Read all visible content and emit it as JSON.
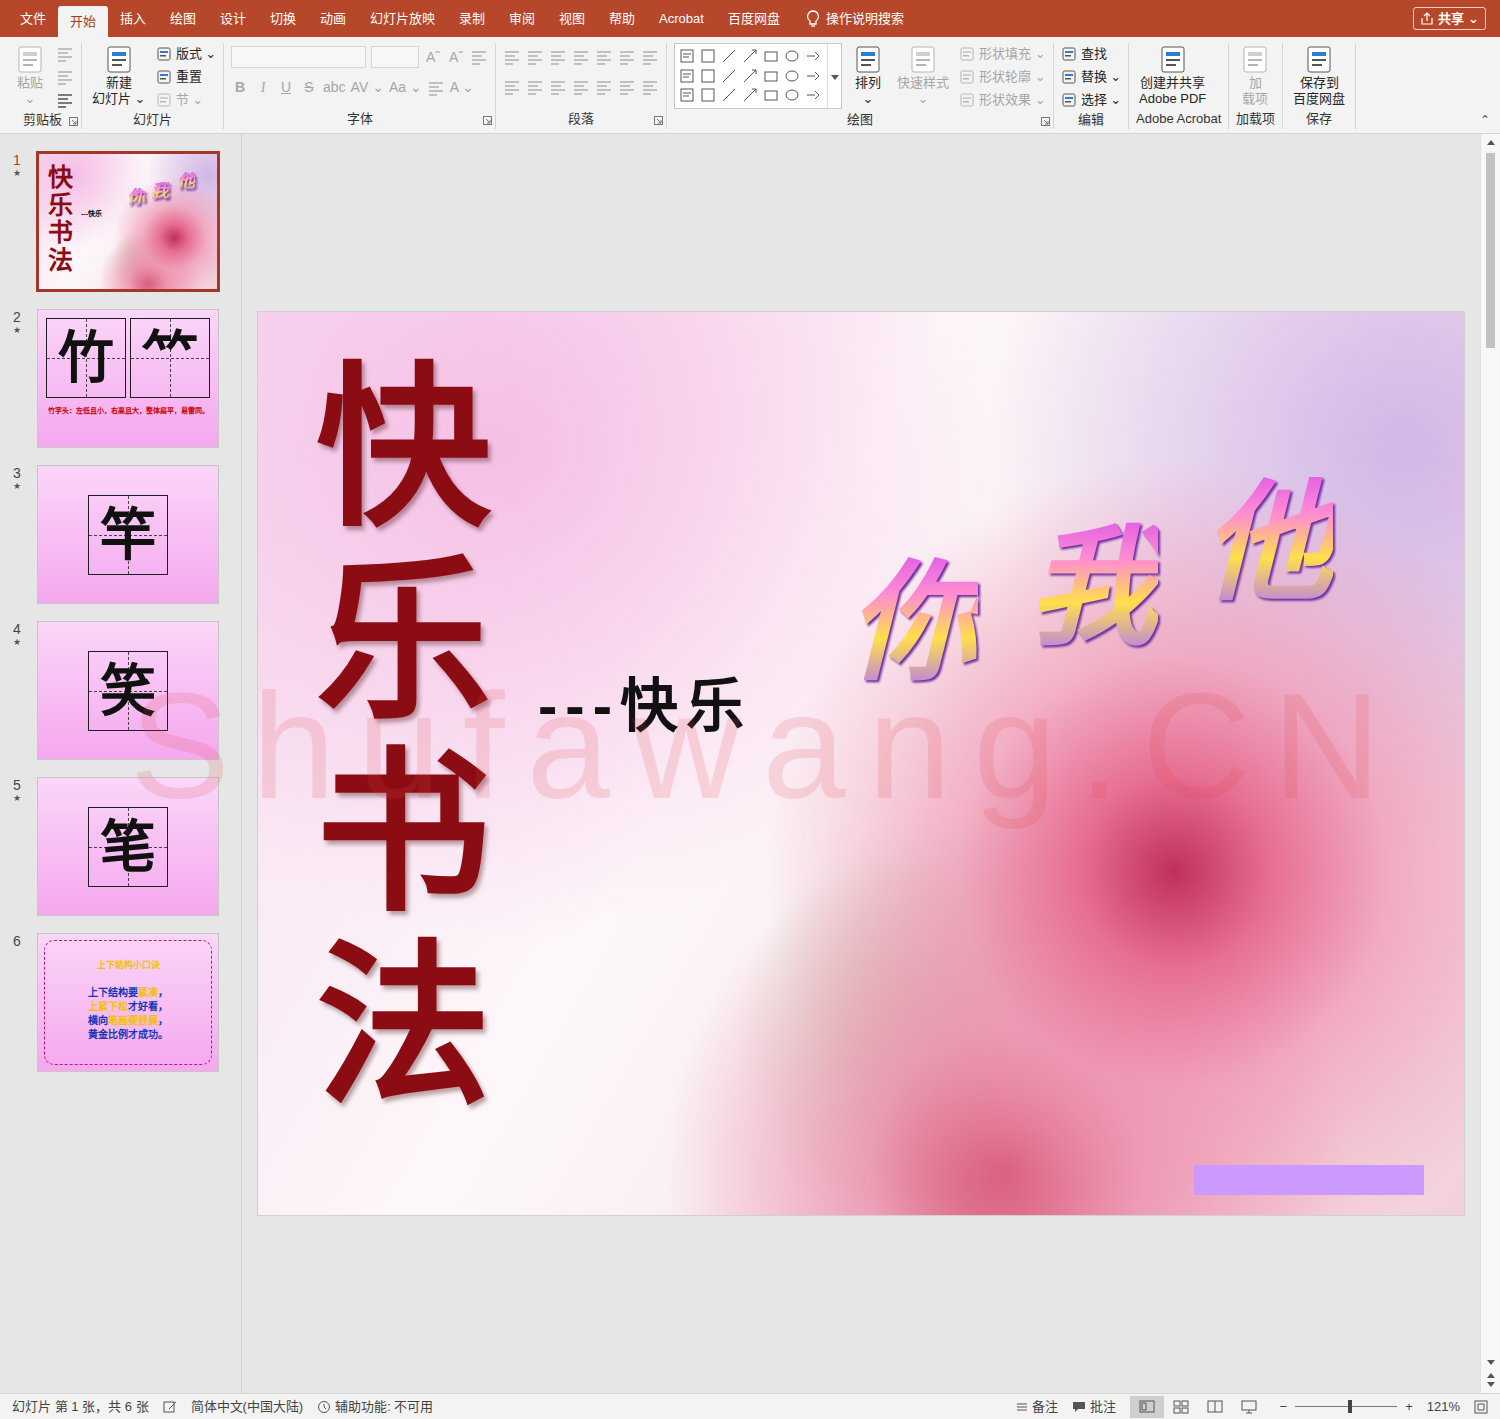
{
  "menu": {
    "tabs": [
      {
        "label": "文件",
        "selected": false
      },
      {
        "label": "开始",
        "selected": true
      },
      {
        "label": "插入",
        "selected": false
      },
      {
        "label": "绘图",
        "selected": false
      },
      {
        "label": "设计",
        "selected": false
      },
      {
        "label": "切换",
        "selected": false
      },
      {
        "label": "动画",
        "selected": false
      },
      {
        "label": "幻灯片放映",
        "selected": false
      },
      {
        "label": "录制",
        "selected": false
      },
      {
        "label": "审阅",
        "selected": false
      },
      {
        "label": "视图",
        "selected": false
      },
      {
        "label": "帮助",
        "selected": false
      },
      {
        "label": "Acrobat",
        "selected": false
      },
      {
        "label": "百度网盘",
        "selected": false
      }
    ],
    "search": "操作说明搜索",
    "share": "共享",
    "share_arrow": "⌄"
  },
  "ribbon": {
    "collapse": "⌃",
    "groups": [
      {
        "label": "剪贴板",
        "launcher": true,
        "blocks": [
          {
            "kind": "large",
            "lines": [
              "粘贴",
              "⌄"
            ],
            "disabled": true
          },
          {
            "kind": "stack",
            "rows": [
              [
                {
                  "kind": "icon",
                  "disabled": true
                }
              ],
              [
                {
                  "kind": "icon",
                  "disabled": true
                }
              ],
              [
                {
                  "kind": "icon",
                  "disabled": false
                }
              ]
            ]
          }
        ]
      },
      {
        "label": "幻灯片",
        "launcher": false,
        "blocks": [
          {
            "kind": "large",
            "lines": [
              "新建",
              "幻灯片 ⌄"
            ],
            "disabled": false
          },
          {
            "kind": "stack",
            "rows": [
              [
                {
                  "kind": "small",
                  "label": "版式 ⌄",
                  "disabled": false
                }
              ],
              [
                {
                  "kind": "small",
                  "label": "重置",
                  "disabled": false
                }
              ],
              [
                {
                  "kind": "small",
                  "label": "节 ⌄",
                  "disabled": true
                }
              ]
            ]
          }
        ]
      },
      {
        "label": "字体",
        "launcher": true,
        "blocks": [
          {
            "kind": "font",
            "rows": [
              [
                {
                  "kind": "field",
                  "disabled": true
                },
                {
                  "kind": "field",
                  "disabled": true
                },
                {
                  "kind": "glyph",
                  "label": "Aˆ",
                  "disabled": true
                },
                {
                  "kind": "glyph",
                  "label": "Aˇ",
                  "disabled": true
                },
                {
                  "kind": "icon",
                  "disabled": true
                }
              ],
              [
                {
                  "kind": "glyph",
                  "label": "B",
                  "disabled": true
                },
                {
                  "kind": "glyph",
                  "label": "I",
                  "disabled": true
                },
                {
                  "kind": "glyph",
                  "label": "U",
                  "disabled": true
                },
                {
                  "kind": "glyph",
                  "label": "S",
                  "disabled": true
                },
                {
                  "kind": "glyph",
                  "label": "abc",
                  "disabled": true
                },
                {
                  "kind": "glyph",
                  "label": "AV ⌄",
                  "disabled": true
                },
                {
                  "kind": "glyph",
                  "label": "Aa ⌄",
                  "disabled": true
                },
                {
                  "kind": "icon",
                  "disabled": true
                },
                {
                  "kind": "glyph",
                  "label": "A ⌄",
                  "disabled": true
                }
              ]
            ]
          }
        ]
      },
      {
        "label": "段落",
        "launcher": true,
        "blocks": [
          {
            "kind": "font",
            "rows": [
              [
                {
                  "kind": "icon",
                  "disabled": true
                },
                {
                  "kind": "icon",
                  "disabled": true
                },
                {
                  "kind": "icon",
                  "disabled": true
                },
                {
                  "kind": "icon",
                  "disabled": true
                },
                {
                  "kind": "icon",
                  "disabled": true
                },
                {
                  "kind": "icon",
                  "disabled": true
                },
                {
                  "kind": "icon",
                  "disabled": true
                }
              ],
              [
                {
                  "kind": "icon",
                  "disabled": true
                },
                {
                  "kind": "icon",
                  "disabled": true
                },
                {
                  "kind": "icon",
                  "disabled": true
                },
                {
                  "kind": "icon",
                  "disabled": true
                },
                {
                  "kind": "icon",
                  "disabled": true
                },
                {
                  "kind": "icon",
                  "disabled": true
                },
                {
                  "kind": "icon",
                  "disabled": true
                }
              ]
            ]
          }
        ]
      },
      {
        "label": "绘图",
        "launcher": true,
        "blocks": [
          {
            "kind": "gallery"
          },
          {
            "kind": "large",
            "lines": [
              "排列",
              "⌄"
            ],
            "disabled": false
          },
          {
            "kind": "large",
            "lines": [
              "快速样式",
              "⌄"
            ],
            "disabled": true
          },
          {
            "kind": "stack",
            "rows": [
              [
                {
                  "kind": "small",
                  "label": "形状填充 ⌄",
                  "disabled": true
                }
              ],
              [
                {
                  "kind": "small",
                  "label": "形状轮廓 ⌄",
                  "disabled": true
                }
              ],
              [
                {
                  "kind": "small",
                  "label": "形状效果 ⌄",
                  "disabled": true
                }
              ]
            ]
          }
        ]
      },
      {
        "label": "编辑",
        "launcher": false,
        "blocks": [
          {
            "kind": "stack",
            "rows": [
              [
                {
                  "kind": "small",
                  "label": "查找",
                  "disabled": false
                }
              ],
              [
                {
                  "kind": "small",
                  "label": "替换 ⌄",
                  "disabled": false
                }
              ],
              [
                {
                  "kind": "small",
                  "label": "选择 ⌄",
                  "disabled": false
                }
              ]
            ]
          }
        ]
      },
      {
        "label": "Adobe Acrobat",
        "launcher": false,
        "blocks": [
          {
            "kind": "large",
            "lines": [
              "创建并共享",
              "Adobe PDF"
            ],
            "disabled": false
          }
        ]
      },
      {
        "label": "加载项",
        "launcher": false,
        "blocks": [
          {
            "kind": "large",
            "lines": [
              "加",
              "载项"
            ],
            "disabled": true
          }
        ]
      },
      {
        "label": "保存",
        "launcher": false,
        "blocks": [
          {
            "kind": "large",
            "lines": [
              "保存到",
              "百度网盘"
            ],
            "disabled": false
          }
        ]
      }
    ]
  },
  "thumbnails": [
    {
      "number": "1",
      "star": "★",
      "selected": true,
      "kind": "title",
      "title": "快乐书法",
      "subtitle": "---快乐",
      "names": [
        "你",
        "我",
        "他"
      ]
    },
    {
      "number": "2",
      "star": "★",
      "selected": false,
      "kind": "char-pair",
      "chars": [
        "竹",
        "⺮"
      ],
      "note": "竹字头：左低且小，右高且大，整体扁平，易雷同。"
    },
    {
      "number": "3",
      "star": "★",
      "selected": false,
      "kind": "char",
      "chars": [
        "竿"
      ]
    },
    {
      "number": "4",
      "star": "★",
      "selected": false,
      "kind": "char",
      "chars": [
        "笑"
      ]
    },
    {
      "number": "5",
      "star": "★",
      "selected": false,
      "kind": "char",
      "chars": [
        "笔"
      ]
    },
    {
      "number": "6",
      "selected": false,
      "kind": "poem",
      "title": "上下结构小口诀",
      "lines": [
        [
          {
            "text": "上下结构要",
            "highlight": false
          },
          {
            "text": "紧凑",
            "highlight": true
          },
          {
            "text": "，",
            "highlight": false
          }
        ],
        [
          {
            "text": "上紧下松",
            "highlight": true
          },
          {
            "text": "才好看，",
            "highlight": false
          }
        ],
        [
          {
            "text": "横向",
            "highlight": false
          },
          {
            "text": "笔画要舒展",
            "highlight": true
          },
          {
            "text": "，",
            "highlight": false
          }
        ],
        [
          {
            "text": "黄金比例才成功。",
            "highlight": false
          }
        ]
      ]
    }
  ],
  "slide": {
    "title": "快乐书法",
    "subtitle": "---快乐",
    "names": [
      "你",
      "我",
      "他"
    ],
    "watermark": "Shufawang.CN"
  },
  "status_bar": {
    "slide_info": "幻灯片 第 1 张，共 6 张",
    "language": "简体中文(中国大陆)",
    "accessibility": "辅助功能: 不可用",
    "notes": "备注",
    "comments": "批注",
    "views": [
      {
        "selected": true
      },
      {
        "selected": false
      },
      {
        "selected": false
      },
      {
        "selected": false
      }
    ],
    "zoom": {
      "minus": "−",
      "plus": "+",
      "level": 0.54,
      "reading": "121%"
    }
  }
}
